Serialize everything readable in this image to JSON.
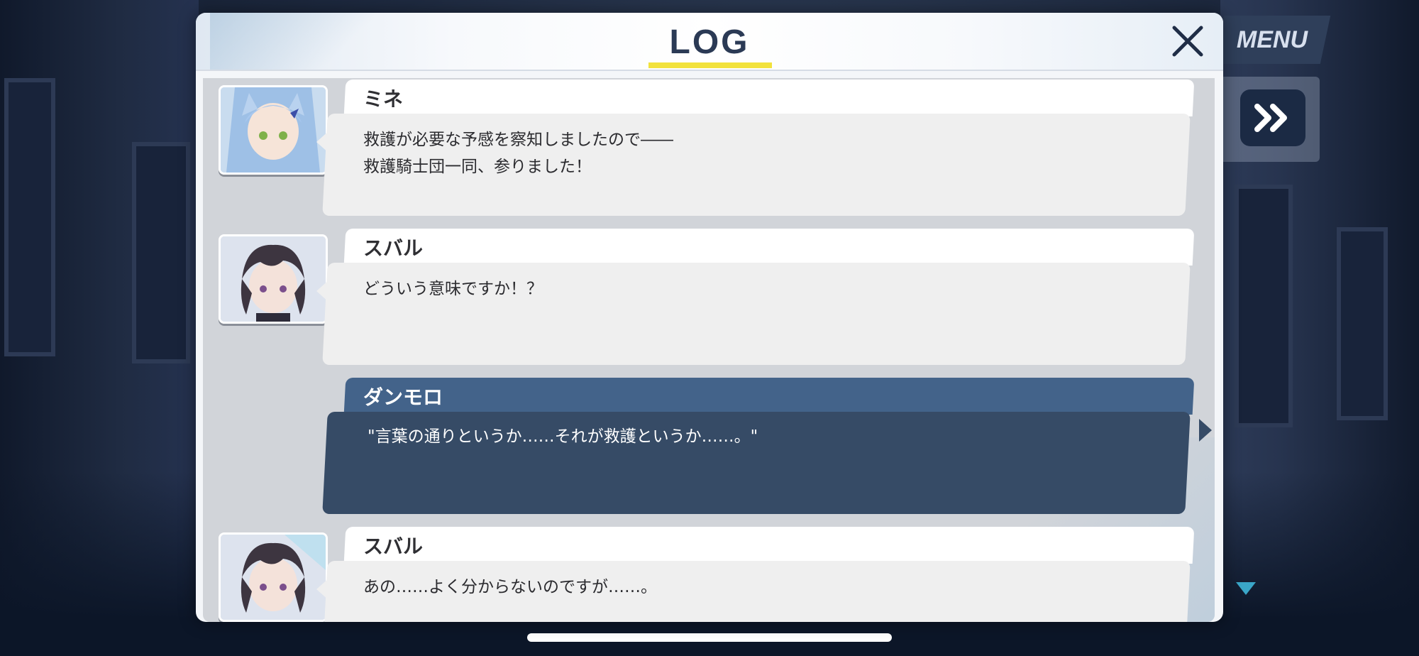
{
  "hud": {
    "menu_label": "MENU",
    "skip_icon": "double-chevron-right-icon"
  },
  "dialog": {
    "title": "LOG",
    "close_icon": "close-icon",
    "entries": [
      {
        "speaker": "ミネ",
        "lines": [
          "救護が必要な予感を察知しましたので――",
          "救護騎士団一同、参りました！"
        ],
        "avatar": "mine-portrait"
      },
      {
        "speaker": "スバル",
        "lines": [
          "どういう意味ですか！？"
        ],
        "avatar": "subaru-portrait"
      },
      {
        "speaker": "ダンモロ",
        "lines": [
          "\"言葉の通りというか……それが救護というか……。\""
        ],
        "avatar": null
      },
      {
        "speaker": "スバル",
        "lines": [
          "あの……よく分からないのですが……。"
        ],
        "avatar": "subaru-portrait"
      }
    ]
  },
  "colors": {
    "title": "#2b3a55",
    "title_underline": "#f2e23c",
    "narrator_name_bar": "#43638a",
    "narrator_bubble": "#364b66"
  }
}
